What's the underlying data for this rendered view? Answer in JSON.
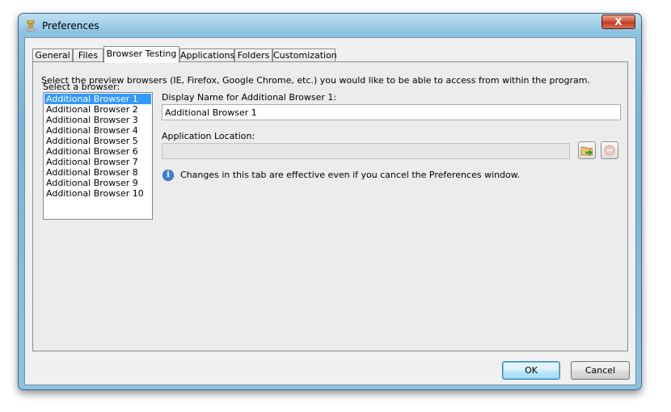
{
  "window": {
    "title": "Preferences",
    "close_label": "X"
  },
  "tabs": [
    {
      "label": "General"
    },
    {
      "label": "Files"
    },
    {
      "label": "Browser Testing",
      "active": true
    },
    {
      "label": "Applications"
    },
    {
      "label": "Folders"
    },
    {
      "label": "Customization"
    }
  ],
  "panel": {
    "description": "Select the preview browsers (IE, Firefox, Google Chrome, etc.) you would like to be able to access from within the program.",
    "list_label": "Select a browser:",
    "browsers": [
      "Additional Browser 1",
      "Additional Browser 2",
      "Additional Browser 3",
      "Additional Browser 4",
      "Additional Browser 5",
      "Additional Browser 6",
      "Additional Browser 7",
      "Additional Browser 8",
      "Additional Browser 9",
      "Additional Browser 10"
    ],
    "selected_index": 0,
    "display_name_label": "Display Name for Additional Browser 1:",
    "display_name_value": "Additional Browser 1",
    "location_label": "Application Location:",
    "location_value": "",
    "info_text": "Changes in this tab are effective even if you cancel the Preferences window."
  },
  "buttons": {
    "ok": "OK",
    "cancel": "Cancel"
  },
  "colors": {
    "selection": "#3399ff",
    "titlebar": "#8dc2e0",
    "close": "#c23a20"
  },
  "icons": {
    "app": "preferences-app-icon",
    "browse": "browse-folder-icon",
    "remove": "remove-icon",
    "info": "info-icon"
  }
}
